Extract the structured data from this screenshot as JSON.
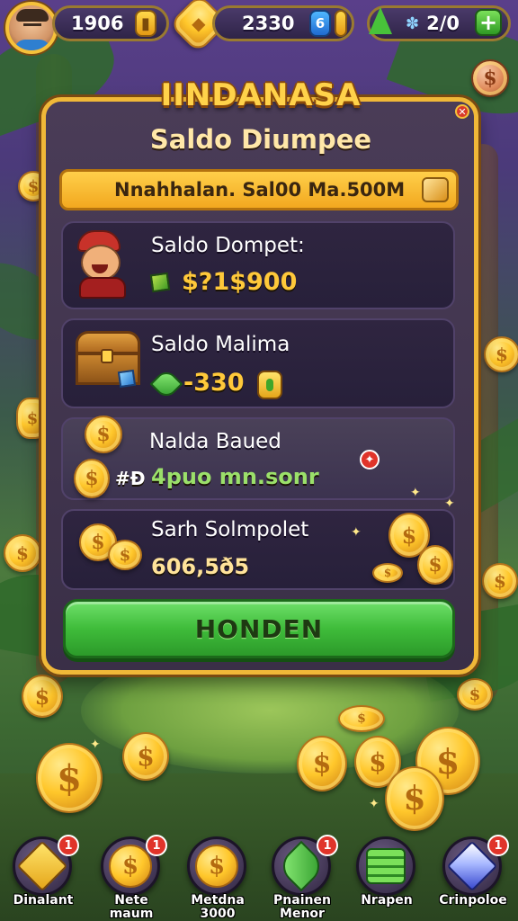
{
  "hud": {
    "coins_value": "1906",
    "gems_value": "2330",
    "gem_chip_label": "6",
    "leaf_value": "2/0",
    "add_label": "+"
  },
  "panel": {
    "title": "IINDANASA",
    "subtitle": "Saldo Diumpee",
    "info_text": "Nnahhalan. Sal00 Ma.500M",
    "cards": [
      {
        "title": "Saldo Dompet:",
        "value": "$?1$900"
      },
      {
        "title": "Saldo Malima",
        "value": "-330"
      },
      {
        "title": "Nalda Baued",
        "prefix": "#Ð",
        "value": "4puo mn.sonr"
      },
      {
        "title": "Sarh Solmpolet",
        "value": "606,5ð5"
      }
    ],
    "primary_button": "HONDEN"
  },
  "bottom_nav": [
    {
      "label": "Dinalant",
      "badge": "1"
    },
    {
      "label": "Nete\nmaum",
      "badge": "1"
    },
    {
      "label": "Metdna\n3000",
      "badge": ""
    },
    {
      "label": "Pnainen\nMenor",
      "badge": "1"
    },
    {
      "label": "Nrapen",
      "badge": ""
    },
    {
      "label": "Crinpoloe",
      "badge": "1"
    }
  ],
  "colors": {
    "accent_gold": "#f0b838",
    "panel_bg": "#3a2f47",
    "primary_green": "#3fbc3a",
    "value_gold": "#ffc93a",
    "value_green": "#9be06a",
    "badge_red": "#e0342a"
  },
  "icons": {
    "currency": "coin-icon",
    "gem": "gem-icon",
    "leaf": "leaf-icon",
    "add": "plus-icon"
  }
}
